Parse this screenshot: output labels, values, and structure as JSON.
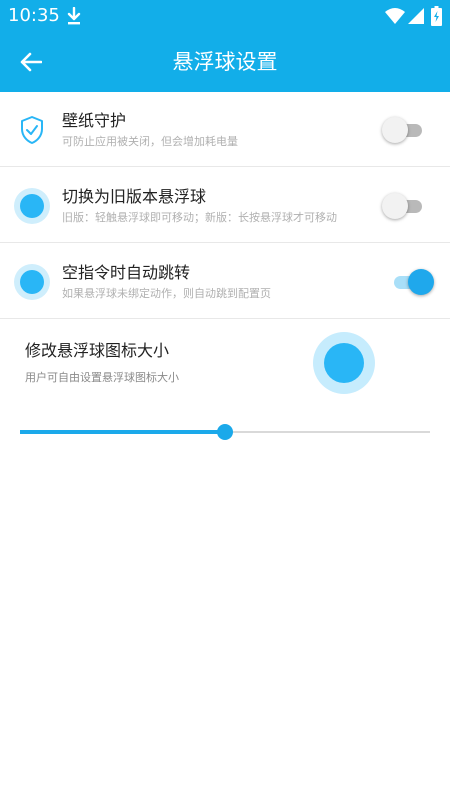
{
  "status_bar": {
    "time": "10:35"
  },
  "app_bar": {
    "title": "悬浮球设置"
  },
  "settings": [
    {
      "title": "壁纸守护",
      "subtitle": "可防止应用被关闭，但会增加耗电量",
      "enabled": false
    },
    {
      "title": "切换为旧版本悬浮球",
      "subtitle": "旧版：轻触悬浮球即可移动；新版：长按悬浮球才可移动",
      "enabled": false
    },
    {
      "title": "空指令时自动跳转",
      "subtitle": "如果悬浮球未绑定动作，则自动跳到配置页",
      "enabled": true
    }
  ],
  "size_setting": {
    "title": "修改悬浮球图标大小",
    "subtitle": "用户可自由设置悬浮球图标大小",
    "value_fraction": 0.5
  },
  "colors": {
    "primary": "#12aee9",
    "accent": "#29b6f6",
    "toggle_on": "#1fa8ec",
    "toggle_off_track": "#b9b9b9"
  },
  "icons": [
    "download-icon",
    "wifi-icon",
    "signal-icon",
    "battery-icon",
    "back-arrow-icon",
    "shield-check-icon",
    "float-ball-icon"
  ]
}
